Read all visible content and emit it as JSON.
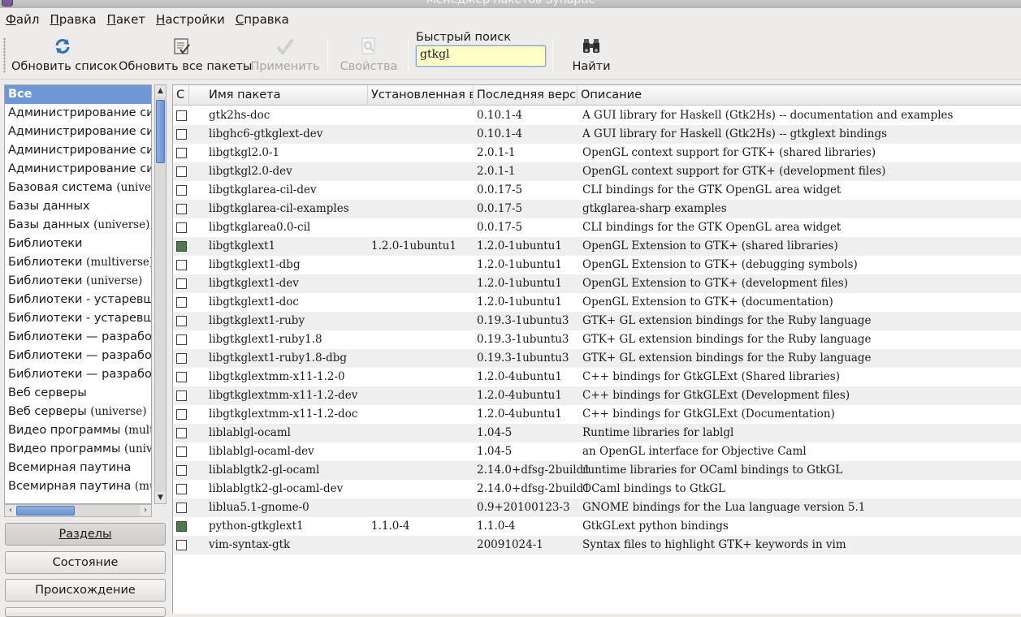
{
  "window": {
    "title": "Менеджер пакетов Synaptic"
  },
  "menu": [
    {
      "label": "Файл",
      "ul": "Ф",
      "rest": "айл"
    },
    {
      "label": "Правка",
      "ul": "П",
      "rest": "равка"
    },
    {
      "label": "Пакет",
      "ul": "П",
      "rest": "акет"
    },
    {
      "label": "Настройки",
      "ul": "Н",
      "rest": "астройки"
    },
    {
      "label": "Справка",
      "ul": "С",
      "rest": "правка"
    }
  ],
  "toolbar": {
    "reload_label": "Обновить список",
    "upgrade_label": "Обновить все пакеты",
    "apply_label": "Применить",
    "properties_label": "Свойства",
    "search_label": "Найти"
  },
  "quick_search": {
    "label": "Быстрый поиск",
    "value": "gtkgl"
  },
  "categories": [
    {
      "main": "Все",
      "sub": ""
    },
    {
      "main": "Администрирование системы",
      "sub": ""
    },
    {
      "main": "Администрирование системы",
      "sub": ""
    },
    {
      "main": "Администрирование системы",
      "sub": ""
    },
    {
      "main": "Администрирование системы",
      "sub": ""
    },
    {
      "main": "Базовая система ",
      "sub": "(universe)"
    },
    {
      "main": "Базы данных",
      "sub": ""
    },
    {
      "main": "Базы данных ",
      "sub": "(universe)"
    },
    {
      "main": "Библиотеки",
      "sub": ""
    },
    {
      "main": "Библиотеки ",
      "sub": "(multiverse)"
    },
    {
      "main": "Библиотеки ",
      "sub": "(universe)"
    },
    {
      "main": "Библиотеки - устаревшие",
      "sub": ""
    },
    {
      "main": "Библиотеки - устаревшие",
      "sub": ""
    },
    {
      "main": "Библиотеки — разработка",
      "sub": ""
    },
    {
      "main": "Библиотеки — разработка",
      "sub": ""
    },
    {
      "main": "Библиотеки — разработка",
      "sub": ""
    },
    {
      "main": "Веб серверы",
      "sub": ""
    },
    {
      "main": "Веб серверы ",
      "sub": "(universe)"
    },
    {
      "main": "Видео программы ",
      "sub": "(multiverse)"
    },
    {
      "main": "Видео программы ",
      "sub": "(universe)"
    },
    {
      "main": "Всемирная паутина",
      "sub": ""
    },
    {
      "main": "Всемирная паутина ",
      "sub": "(multiverse)"
    }
  ],
  "side_buttons": {
    "sections": "Разделы",
    "status": "Состояние",
    "origin": "Происхождение"
  },
  "columns": {
    "status": "С",
    "name": "Имя пакета",
    "installed": "Установленная в",
    "latest": "Последняя верси",
    "description": "Описание"
  },
  "packages": [
    {
      "name": "gtk2hs-doc",
      "installed": "",
      "latest": "0.10.1-4",
      "description": "A GUI library for Haskell (Gtk2Hs) -- documentation and examples",
      "is_installed": false
    },
    {
      "name": "libghc6-gtkglext-dev",
      "installed": "",
      "latest": "0.10.1-4",
      "description": "A GUI library for Haskell (Gtk2Hs) -- gtkglext bindings",
      "is_installed": false
    },
    {
      "name": "libgtkgl2.0-1",
      "installed": "",
      "latest": "2.0.1-1",
      "description": "OpenGL context support for GTK+ (shared libraries)",
      "is_installed": false
    },
    {
      "name": "libgtkgl2.0-dev",
      "installed": "",
      "latest": "2.0.1-1",
      "description": "OpenGL context support for GTK+ (development files)",
      "is_installed": false
    },
    {
      "name": "libgtkglarea-cil-dev",
      "installed": "",
      "latest": "0.0.17-5",
      "description": "CLI bindings for the GTK OpenGL area widget",
      "is_installed": false
    },
    {
      "name": "libgtkglarea-cil-examples",
      "installed": "",
      "latest": "0.0.17-5",
      "description": "gtkglarea-sharp examples",
      "is_installed": false
    },
    {
      "name": "libgtkglarea0.0-cil",
      "installed": "",
      "latest": "0.0.17-5",
      "description": "CLI bindings for the GTK OpenGL area widget",
      "is_installed": false
    },
    {
      "name": "libgtkglext1",
      "installed": "1.2.0-1ubuntu1",
      "latest": "1.2.0-1ubuntu1",
      "description": "OpenGL Extension to GTK+ (shared libraries)",
      "is_installed": true
    },
    {
      "name": "libgtkglext1-dbg",
      "installed": "",
      "latest": "1.2.0-1ubuntu1",
      "description": "OpenGL Extension to GTK+ (debugging symbols)",
      "is_installed": false
    },
    {
      "name": "libgtkglext1-dev",
      "installed": "",
      "latest": "1.2.0-1ubuntu1",
      "description": "OpenGL Extension to GTK+ (development files)",
      "is_installed": false
    },
    {
      "name": "libgtkglext1-doc",
      "installed": "",
      "latest": "1.2.0-1ubuntu1",
      "description": "OpenGL Extension to GTK+ (documentation)",
      "is_installed": false
    },
    {
      "name": "libgtkglext1-ruby",
      "installed": "",
      "latest": "0.19.3-1ubuntu3",
      "description": "GTK+ GL extension bindings for the Ruby language",
      "is_installed": false
    },
    {
      "name": "libgtkglext1-ruby1.8",
      "installed": "",
      "latest": "0.19.3-1ubuntu3",
      "description": "GTK+ GL extension bindings for the Ruby language",
      "is_installed": false
    },
    {
      "name": "libgtkglext1-ruby1.8-dbg",
      "installed": "",
      "latest": "0.19.3-1ubuntu3",
      "description": "GTK+ GL extension bindings for the Ruby language",
      "is_installed": false
    },
    {
      "name": "libgtkglextmm-x11-1.2-0",
      "installed": "",
      "latest": "1.2.0-4ubuntu1",
      "description": "C++ bindings for GtkGLExt (Shared libraries)",
      "is_installed": false
    },
    {
      "name": "libgtkglextmm-x11-1.2-dev",
      "installed": "",
      "latest": "1.2.0-4ubuntu1",
      "description": "C++ bindings for GtkGLExt (Development files)",
      "is_installed": false
    },
    {
      "name": "libgtkglextmm-x11-1.2-doc",
      "installed": "",
      "latest": "1.2.0-4ubuntu1",
      "description": "C++ bindings for GtkGLExt (Documentation)",
      "is_installed": false
    },
    {
      "name": "liblablgl-ocaml",
      "installed": "",
      "latest": "1.04-5",
      "description": "Runtime libraries for lablgl",
      "is_installed": false
    },
    {
      "name": "liblablgl-ocaml-dev",
      "installed": "",
      "latest": "1.04-5",
      "description": "an OpenGL interface for Objective Caml",
      "is_installed": false
    },
    {
      "name": "liblablgtk2-gl-ocaml",
      "installed": "",
      "latest": "2.14.0+dfsg-2build1",
      "description": "runtime libraries for OCaml bindings to GtkGL",
      "is_installed": false
    },
    {
      "name": "liblablgtk2-gl-ocaml-dev",
      "installed": "",
      "latest": "2.14.0+dfsg-2build1",
      "description": "OCaml bindings to GtkGL",
      "is_installed": false
    },
    {
      "name": "liblua5.1-gnome-0",
      "installed": "",
      "latest": "0.9+20100123-3",
      "description": "GNOME bindings for the Lua language version 5.1",
      "is_installed": false
    },
    {
      "name": "python-gtkglext1",
      "installed": "1.1.0-4",
      "latest": "1.1.0-4",
      "description": "GtkGLext python bindings",
      "is_installed": true
    },
    {
      "name": "vim-syntax-gtk",
      "installed": "",
      "latest": "20091024-1",
      "description": "Syntax files to highlight GTK+ keywords in vim",
      "is_installed": false
    }
  ],
  "colors": {
    "selection": "#6e98d5",
    "installed_checkbox": "#4f7a4f",
    "quick_search_bg": "#ffffc8",
    "alt_row": "#efefef"
  }
}
